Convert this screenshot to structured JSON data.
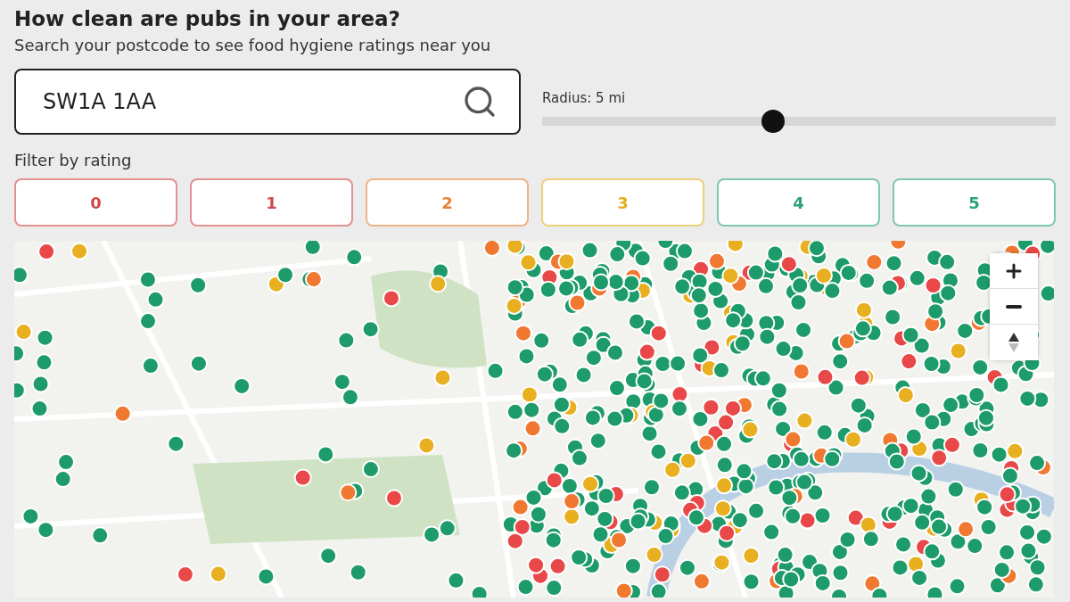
{
  "title": "How clean are pubs in your area?",
  "subtitle": "Search your postcode to see food hygiene ratings near you",
  "search": {
    "value": "SW1A 1AA"
  },
  "radius": {
    "label": "Radius: 5 mi",
    "level": 0.45
  },
  "filter": {
    "label": "Filter by rating",
    "ratings": [
      {
        "label": "0",
        "color": "#d04848"
      },
      {
        "label": "1",
        "color": "#d04848"
      },
      {
        "label": "2",
        "color": "#e8823a"
      },
      {
        "label": "3",
        "color": "#e0b020"
      },
      {
        "label": "4",
        "color": "#2aa27a"
      },
      {
        "label": "5",
        "color": "#2aa27a"
      }
    ]
  }
}
